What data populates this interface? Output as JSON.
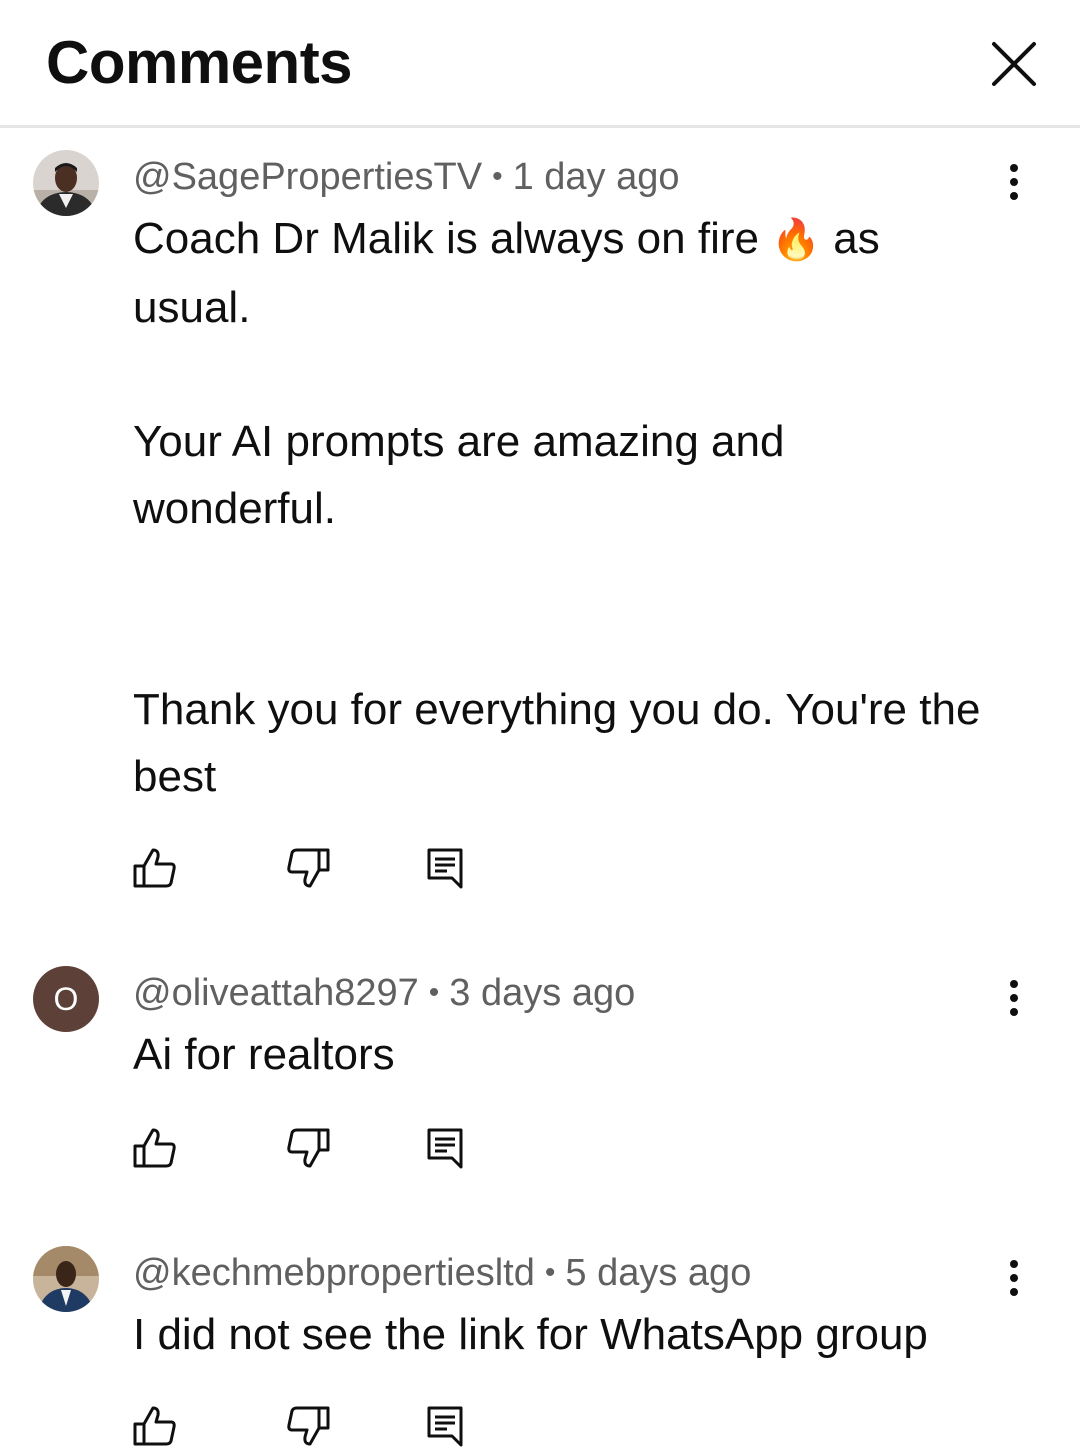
{
  "header": {
    "title": "Comments",
    "close_icon": "close-icon"
  },
  "comments": [
    {
      "handle": "@SagePropertiesTV",
      "separator": "•",
      "time": "1 day ago",
      "text_before_emoji": "Coach Dr Malik is always on fire ",
      "emoji": "🔥",
      "text_after_emoji": " as\nusual.\n\nYour AI prompts are amazing and\nwonderful.\n\n\nThank you for everything you do. You're the\nbest",
      "avatar": "photo-avatar"
    },
    {
      "handle": "@oliveattah8297",
      "separator": "•",
      "time": "3 days ago",
      "text": "Ai for realtors",
      "avatar_letter": "O",
      "avatar_color": "#5d4037"
    },
    {
      "handle": "@kechmebpropertiesltd",
      "separator": "•",
      "time": "5 days ago",
      "text": "I did not see the link for WhatsApp group",
      "avatar": "photo-avatar"
    }
  ],
  "icons": {
    "like": "thumbs-up-icon",
    "dislike": "thumbs-down-icon",
    "reply": "reply-icon",
    "more": "more-vert-icon"
  }
}
